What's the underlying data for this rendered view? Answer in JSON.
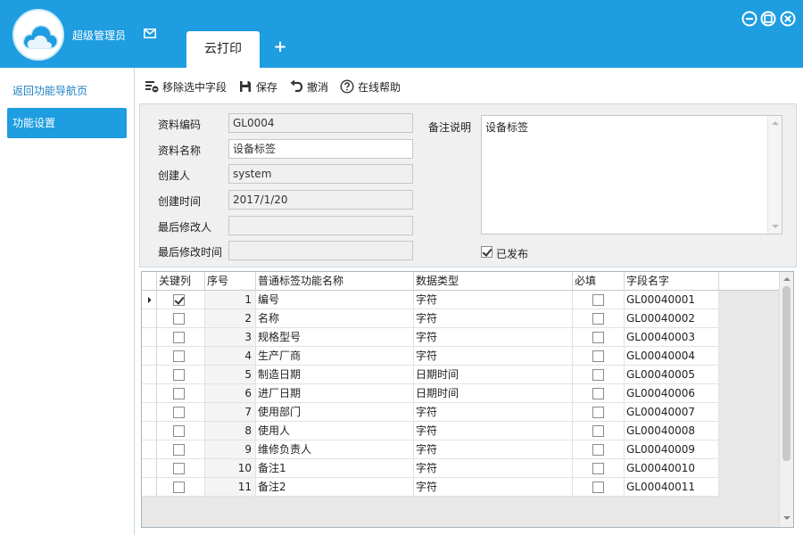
{
  "app": {
    "user_name": "超级管理员",
    "active_tab": "云打印",
    "add_tab": "+"
  },
  "sidebar": {
    "back_label": "返回功能导航页",
    "active_label": "功能设置"
  },
  "toolbar": {
    "remove_field": "移除选中字段",
    "save": "保存",
    "undo": "撤消",
    "help": "在线帮助"
  },
  "form": {
    "code_label": "资料编码",
    "code_value": "GL0004",
    "name_label": "资料名称",
    "name_value": "设备标签",
    "creator_label": "创建人",
    "creator_value": "system",
    "created_label": "创建时间",
    "created_value": "2017/1/20",
    "modifier_label": "最后修改人",
    "modifier_value": "",
    "modified_label": "最后修改时间",
    "modified_value": "",
    "remark_label": "备注说明",
    "remark_value": "设备标签",
    "published_label": "已发布",
    "published": true
  },
  "grid": {
    "headers": [
      "关键列",
      "序号",
      "普通标签功能名称",
      "数据类型",
      "必填",
      "字段名字"
    ],
    "rows": [
      {
        "key": true,
        "seq": "1",
        "name": "编号",
        "type": "字符",
        "required": false,
        "field": "GL00040001"
      },
      {
        "key": false,
        "seq": "2",
        "name": "名称",
        "type": "字符",
        "required": false,
        "field": "GL00040002"
      },
      {
        "key": false,
        "seq": "3",
        "name": "规格型号",
        "type": "字符",
        "required": false,
        "field": "GL00040003"
      },
      {
        "key": false,
        "seq": "4",
        "name": "生产厂商",
        "type": "字符",
        "required": false,
        "field": "GL00040004"
      },
      {
        "key": false,
        "seq": "5",
        "name": "制造日期",
        "type": "日期时间",
        "required": false,
        "field": "GL00040005"
      },
      {
        "key": false,
        "seq": "6",
        "name": "进厂日期",
        "type": "日期时间",
        "required": false,
        "field": "GL00040006"
      },
      {
        "key": false,
        "seq": "7",
        "name": "使用部门",
        "type": "字符",
        "required": false,
        "field": "GL00040007"
      },
      {
        "key": false,
        "seq": "8",
        "name": "使用人",
        "type": "字符",
        "required": false,
        "field": "GL00040008"
      },
      {
        "key": false,
        "seq": "9",
        "name": "维修负责人",
        "type": "字符",
        "required": false,
        "field": "GL00040009"
      },
      {
        "key": false,
        "seq": "10",
        "name": "备注1",
        "type": "字符",
        "required": false,
        "field": "GL00040010"
      },
      {
        "key": false,
        "seq": "11",
        "name": "备注2",
        "type": "字符",
        "required": false,
        "field": "GL00040011"
      }
    ]
  },
  "colors": {
    "accent": "#1e9de1",
    "link": "#1e7fc4"
  },
  "icons": [
    "cloud-logo-icon",
    "mail-icon",
    "minimize-icon",
    "restore-icon",
    "close-icon",
    "remove-field-icon",
    "save-icon",
    "undo-icon",
    "help-icon",
    "row-pointer-icon"
  ]
}
